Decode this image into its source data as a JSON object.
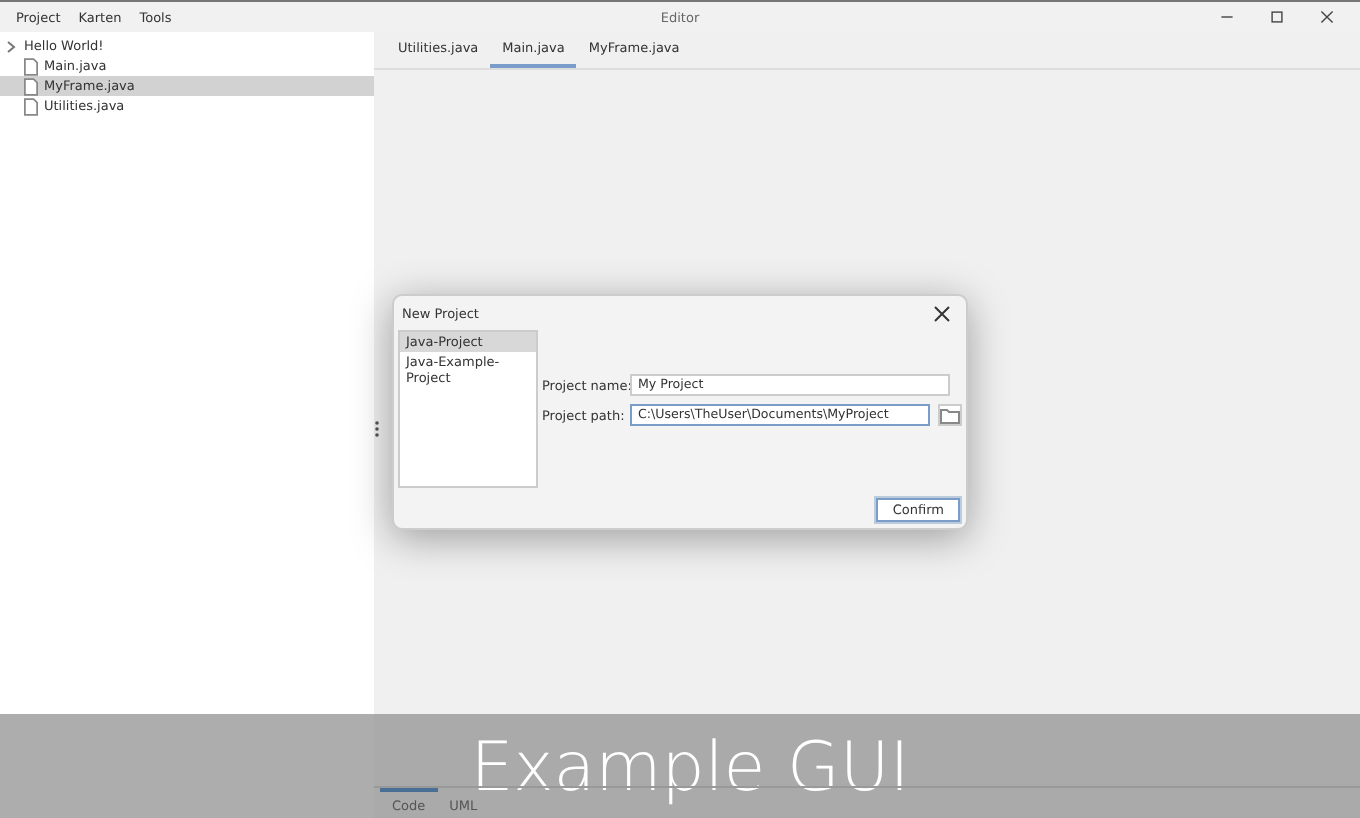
{
  "window": {
    "title": "Editor"
  },
  "menu": [
    "Project",
    "Karten",
    "Tools"
  ],
  "tree": {
    "label": "Hello World!",
    "children": [
      {
        "label": "Main.java",
        "selected": false
      },
      {
        "label": "MyFrame.java",
        "selected": true
      },
      {
        "label": "Utilities.java",
        "selected": false
      }
    ]
  },
  "tabs": [
    {
      "label": "Utilities.java",
      "selected": false
    },
    {
      "label": "Main.java",
      "selected": true
    },
    {
      "label": "MyFrame.java",
      "selected": false
    }
  ],
  "bottom_tabs": [
    {
      "label": "Code",
      "selected": true
    },
    {
      "label": "UML",
      "selected": false
    }
  ],
  "dialog": {
    "title": "New Project",
    "templates": [
      {
        "label": "Java-Project",
        "selected": true
      },
      {
        "label": "Java-Example-Project",
        "selected": false
      }
    ],
    "fields": [
      {
        "label": "Project name:",
        "value": "My Project",
        "browse": false
      },
      {
        "label": "Project path:",
        "value": "C:\\Users\\TheUser\\Documents\\MyProject",
        "browse": true
      }
    ],
    "confirm": "Confirm"
  },
  "caption": "Example GUI"
}
